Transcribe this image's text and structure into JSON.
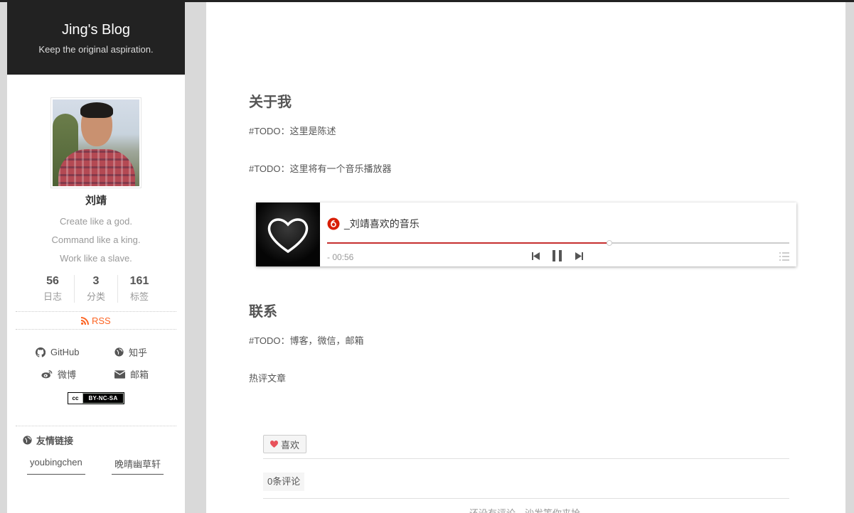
{
  "sidebar": {
    "site_title": "Jing's Blog",
    "site_subtitle": "Keep the original aspiration.",
    "author": "刘靖",
    "motto": [
      "Create like a god.",
      "Command like a king.",
      "Work like a slave."
    ],
    "stats": [
      {
        "num": "56",
        "label": "日志"
      },
      {
        "num": "3",
        "label": "分类"
      },
      {
        "num": "161",
        "label": "标签"
      }
    ],
    "rss": "RSS",
    "social": [
      {
        "label": "GitHub",
        "icon": "github-icon"
      },
      {
        "label": "知乎",
        "icon": "globe-icon"
      },
      {
        "label": "微博",
        "icon": "weibo-icon"
      },
      {
        "label": "邮箱",
        "icon": "envelope-icon"
      }
    ],
    "license": {
      "logo": "cc",
      "text": "BY-NC-SA"
    },
    "friends_title": "友情链接",
    "friends": [
      "youbingchen",
      "晚晴幽草轩"
    ]
  },
  "main": {
    "about_heading": "关于我",
    "about_text": "#TODO：这里是陈述",
    "player_note": "#TODO：这里将有一个音乐播放器",
    "player": {
      "title": "_刘靖喜欢的音乐",
      "time": "- 00:56",
      "progress": 0.61,
      "icons": [
        "netease-music-icon",
        "prev-icon",
        "pause-icon",
        "next-icon",
        "playlist-icon",
        "heart-icon"
      ]
    },
    "contact_heading": "联系",
    "contact_text": "#TODO：博客，微信，邮箱",
    "hot_articles": "热评文章",
    "like_label": "喜欢",
    "comments_label": "0条评论",
    "empty_text": "还没有评论，沙发等你来抢"
  },
  "colors": {
    "accent": "#fc6423",
    "player_red": "#c62f2f",
    "brand_bg": "#222222"
  }
}
